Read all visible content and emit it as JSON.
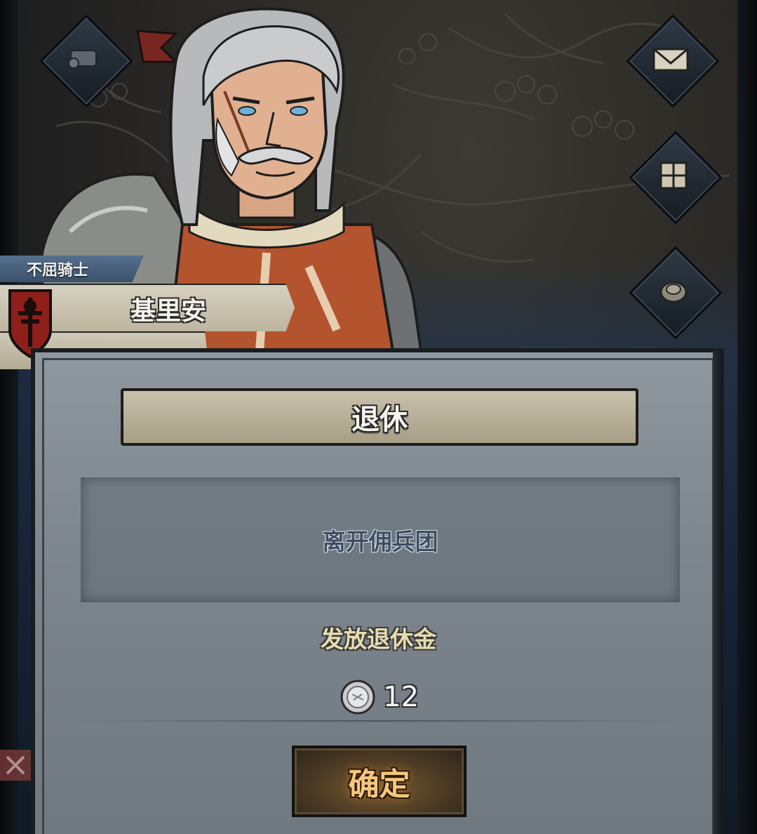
{
  "character": {
    "class_title": "不屈骑士",
    "name": "基里安"
  },
  "dialog": {
    "title": "退休",
    "description": "离开佣兵团",
    "payout_label": "发放退休金",
    "payout_amount": "12",
    "confirm_label": "确定"
  },
  "icons": {
    "top_left": "scroll-icon",
    "top_right": "mail-icon",
    "right_middle": "inventory-grid-icon",
    "right_lower": "coin-purse-icon",
    "left_lower": "crossed-swords-icon",
    "banner": "red-flag-icon"
  },
  "colors": {
    "title_ribbon": "#4a6482",
    "name_plate": "#cfc8b6",
    "panel": "#868f97",
    "header_parchment": "#bdb49e",
    "confirm_text": "#f6c77a",
    "payout_text": "#e7dcb0",
    "description_text": "#3e4d63",
    "shield": "#8e1f1a"
  }
}
